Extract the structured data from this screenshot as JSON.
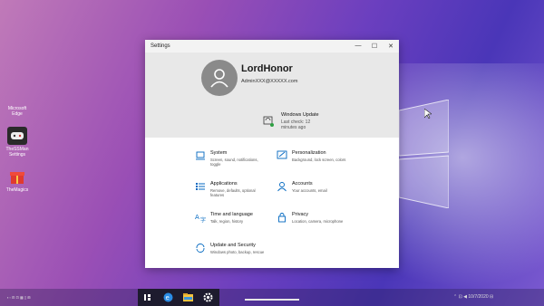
{
  "desktop": {
    "icons": [
      {
        "label": "Microsoft Edge",
        "icon": "edge-icon"
      },
      {
        "label": "TheSSMan Settings",
        "icon": "gamepad-icon"
      },
      {
        "label": "TheMagics",
        "icon": "gift-icon"
      }
    ]
  },
  "settings_window": {
    "title": "Settings",
    "controls": {
      "minimize": "—",
      "maximize": "☐",
      "close": "✕"
    },
    "profile": {
      "username": "LordHonor",
      "email": "AdminXXX@XXXXX.com"
    },
    "windows_update": {
      "title": "Windows Update",
      "subtitle": "Last check: 12 minutes ago"
    },
    "categories": [
      {
        "title": "System",
        "desc": "Screen, sound, notifications, toggle",
        "icon": "laptop-icon"
      },
      {
        "title": "Personalization",
        "desc": "Background, lock screen, colors",
        "icon": "brush-icon"
      },
      {
        "title": "Applications",
        "desc": "Remove, defaults, optional features",
        "icon": "apps-list-icon"
      },
      {
        "title": "Accounts",
        "desc": "Your accounts, email",
        "icon": "person-icon"
      },
      {
        "title": "Time and language",
        "desc": "Talk, region, history",
        "icon": "time-language-icon"
      },
      {
        "title": "Privacy",
        "desc": "Location, camera, microphone",
        "icon": "lock-icon"
      },
      {
        "title": "Update and Security",
        "desc": "Windows photo, backup, rescue",
        "icon": "sync-icon"
      }
    ]
  },
  "taskbar": {
    "left_text": "▪ ▫ ⊟ ⊡ ▦ ▯ ⊞",
    "tray_text": "⌃ ⊡ ◀ 10/7/2020 ⊟"
  },
  "colors": {
    "accent": "#0067c0",
    "header_bg": "#e8e8e8",
    "taskbar": "#1d1b2e"
  }
}
